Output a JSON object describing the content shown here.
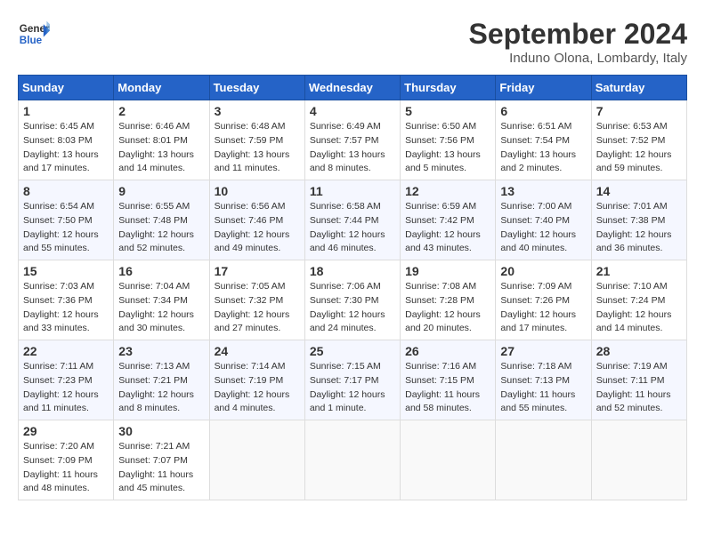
{
  "header": {
    "logo_line1": "General",
    "logo_line2": "Blue",
    "title": "September 2024",
    "subtitle": "Induno Olona, Lombardy, Italy"
  },
  "columns": [
    "Sunday",
    "Monday",
    "Tuesday",
    "Wednesday",
    "Thursday",
    "Friday",
    "Saturday"
  ],
  "weeks": [
    [
      {
        "day": "1",
        "details": "Sunrise: 6:45 AM\nSunset: 8:03 PM\nDaylight: 13 hours and 17 minutes."
      },
      {
        "day": "2",
        "details": "Sunrise: 6:46 AM\nSunset: 8:01 PM\nDaylight: 13 hours and 14 minutes."
      },
      {
        "day": "3",
        "details": "Sunrise: 6:48 AM\nSunset: 7:59 PM\nDaylight: 13 hours and 11 minutes."
      },
      {
        "day": "4",
        "details": "Sunrise: 6:49 AM\nSunset: 7:57 PM\nDaylight: 13 hours and 8 minutes."
      },
      {
        "day": "5",
        "details": "Sunrise: 6:50 AM\nSunset: 7:56 PM\nDaylight: 13 hours and 5 minutes."
      },
      {
        "day": "6",
        "details": "Sunrise: 6:51 AM\nSunset: 7:54 PM\nDaylight: 13 hours and 2 minutes."
      },
      {
        "day": "7",
        "details": "Sunrise: 6:53 AM\nSunset: 7:52 PM\nDaylight: 12 hours and 59 minutes."
      }
    ],
    [
      {
        "day": "8",
        "details": "Sunrise: 6:54 AM\nSunset: 7:50 PM\nDaylight: 12 hours and 55 minutes."
      },
      {
        "day": "9",
        "details": "Sunrise: 6:55 AM\nSunset: 7:48 PM\nDaylight: 12 hours and 52 minutes."
      },
      {
        "day": "10",
        "details": "Sunrise: 6:56 AM\nSunset: 7:46 PM\nDaylight: 12 hours and 49 minutes."
      },
      {
        "day": "11",
        "details": "Sunrise: 6:58 AM\nSunset: 7:44 PM\nDaylight: 12 hours and 46 minutes."
      },
      {
        "day": "12",
        "details": "Sunrise: 6:59 AM\nSunset: 7:42 PM\nDaylight: 12 hours and 43 minutes."
      },
      {
        "day": "13",
        "details": "Sunrise: 7:00 AM\nSunset: 7:40 PM\nDaylight: 12 hours and 40 minutes."
      },
      {
        "day": "14",
        "details": "Sunrise: 7:01 AM\nSunset: 7:38 PM\nDaylight: 12 hours and 36 minutes."
      }
    ],
    [
      {
        "day": "15",
        "details": "Sunrise: 7:03 AM\nSunset: 7:36 PM\nDaylight: 12 hours and 33 minutes."
      },
      {
        "day": "16",
        "details": "Sunrise: 7:04 AM\nSunset: 7:34 PM\nDaylight: 12 hours and 30 minutes."
      },
      {
        "day": "17",
        "details": "Sunrise: 7:05 AM\nSunset: 7:32 PM\nDaylight: 12 hours and 27 minutes."
      },
      {
        "day": "18",
        "details": "Sunrise: 7:06 AM\nSunset: 7:30 PM\nDaylight: 12 hours and 24 minutes."
      },
      {
        "day": "19",
        "details": "Sunrise: 7:08 AM\nSunset: 7:28 PM\nDaylight: 12 hours and 20 minutes."
      },
      {
        "day": "20",
        "details": "Sunrise: 7:09 AM\nSunset: 7:26 PM\nDaylight: 12 hours and 17 minutes."
      },
      {
        "day": "21",
        "details": "Sunrise: 7:10 AM\nSunset: 7:24 PM\nDaylight: 12 hours and 14 minutes."
      }
    ],
    [
      {
        "day": "22",
        "details": "Sunrise: 7:11 AM\nSunset: 7:23 PM\nDaylight: 12 hours and 11 minutes."
      },
      {
        "day": "23",
        "details": "Sunrise: 7:13 AM\nSunset: 7:21 PM\nDaylight: 12 hours and 8 minutes."
      },
      {
        "day": "24",
        "details": "Sunrise: 7:14 AM\nSunset: 7:19 PM\nDaylight: 12 hours and 4 minutes."
      },
      {
        "day": "25",
        "details": "Sunrise: 7:15 AM\nSunset: 7:17 PM\nDaylight: 12 hours and 1 minute."
      },
      {
        "day": "26",
        "details": "Sunrise: 7:16 AM\nSunset: 7:15 PM\nDaylight: 11 hours and 58 minutes."
      },
      {
        "day": "27",
        "details": "Sunrise: 7:18 AM\nSunset: 7:13 PM\nDaylight: 11 hours and 55 minutes."
      },
      {
        "day": "28",
        "details": "Sunrise: 7:19 AM\nSunset: 7:11 PM\nDaylight: 11 hours and 52 minutes."
      }
    ],
    [
      {
        "day": "29",
        "details": "Sunrise: 7:20 AM\nSunset: 7:09 PM\nDaylight: 11 hours and 48 minutes."
      },
      {
        "day": "30",
        "details": "Sunrise: 7:21 AM\nSunset: 7:07 PM\nDaylight: 11 hours and 45 minutes."
      },
      {
        "day": "",
        "details": ""
      },
      {
        "day": "",
        "details": ""
      },
      {
        "day": "",
        "details": ""
      },
      {
        "day": "",
        "details": ""
      },
      {
        "day": "",
        "details": ""
      }
    ]
  ]
}
